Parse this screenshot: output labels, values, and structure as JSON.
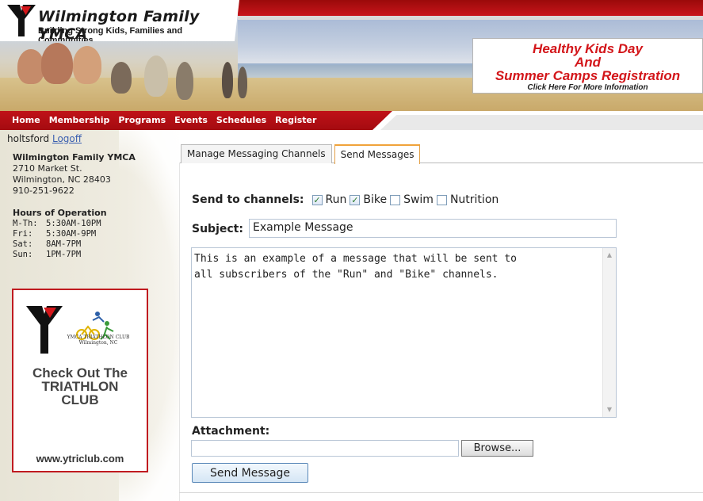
{
  "header": {
    "brand_title": "Wilmington Family YMCA",
    "brand_tagline": "Building Strong Kids, Families and Communities",
    "promo": {
      "line1": "Healthy Kids Day",
      "line2": "And",
      "line3": "Summer Camps Registration",
      "sub": "Click Here For More Information"
    }
  },
  "nav": {
    "items": [
      "Home",
      "Membership",
      "Programs",
      "Events",
      "Schedules",
      "Register"
    ]
  },
  "sidebar": {
    "username": "holtsford",
    "logoff": "Logoff",
    "org_name": "Wilmington Family YMCA",
    "street": "2710 Market St.",
    "city": "Wilmington, NC 28403",
    "phone": "910-251-9622",
    "hours_title": "Hours of Operation",
    "hours": [
      {
        "day": "M-Th:",
        "time": "5:30AM-10PM"
      },
      {
        "day": "Fri:",
        "time": "5:30AM-9PM"
      },
      {
        "day": "Sat:",
        "time": "8AM-7PM"
      },
      {
        "day": "Sun:",
        "time": "1PM-7PM"
      }
    ],
    "ad": {
      "clubname_line1": "YMCA TRIATHLON CLUB",
      "clubname_line2": "Wilmington, NC",
      "headline_line1": "Check Out The",
      "headline_line2": "TRIATHLON",
      "headline_line3": "CLUB",
      "url": "www.ytriclub.com"
    }
  },
  "tabs": [
    {
      "label": "Manage Messaging Channels",
      "active": false
    },
    {
      "label": "Send Messages",
      "active": true
    }
  ],
  "form": {
    "channels_label": "Send to channels:",
    "channels": [
      {
        "label": "Run",
        "checked": true
      },
      {
        "label": "Bike",
        "checked": true
      },
      {
        "label": "Swim",
        "checked": false
      },
      {
        "label": "Nutrition",
        "checked": false
      }
    ],
    "subject_label": "Subject:",
    "subject_value": "Example Message",
    "message_value": "This is an example of a message that will be sent to\nall subscribers of the \"Run\" and \"Bike\" channels.",
    "attachment_label": "Attachment:",
    "browse_label": "Browse...",
    "send_label": "Send Message"
  },
  "colors": {
    "ymca_red": "#c01218",
    "tab_active_border": "#f0a33a",
    "link_blue": "#3a5fb0"
  }
}
